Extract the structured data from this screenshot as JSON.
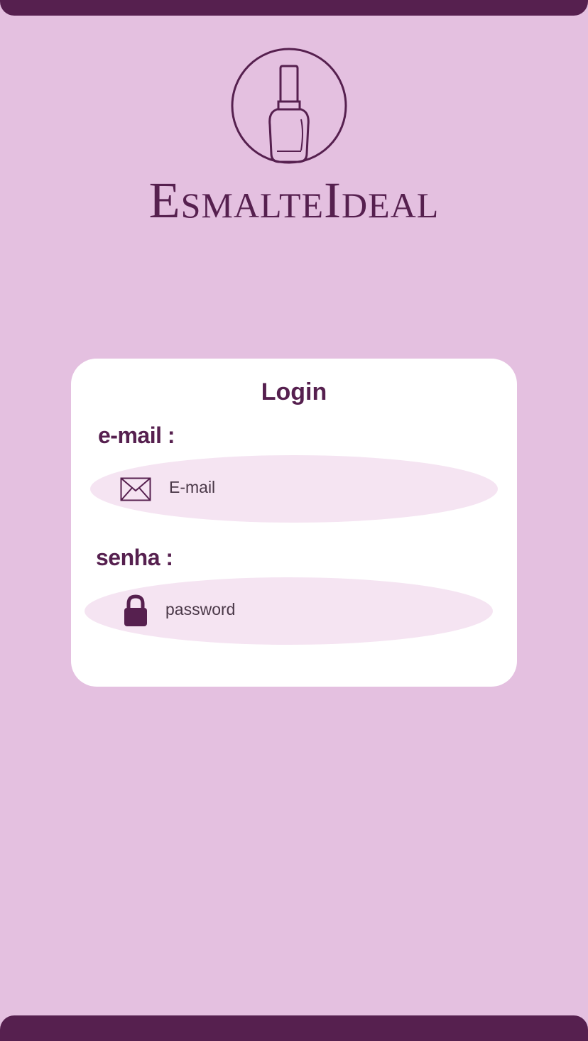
{
  "brand": {
    "name": "EsmalteIdeal"
  },
  "login": {
    "title": "Login",
    "email_label": "e-mail :",
    "email_placeholder": "E-mail",
    "password_label": "senha :",
    "password_placeholder": "password"
  },
  "icons": {
    "logo": "nail-polish-bottle-icon",
    "email": "envelope-icon",
    "password": "lock-icon"
  },
  "colors": {
    "background": "#e4c0e0",
    "brand": "#56204f",
    "card": "#ffffff",
    "field": "#f5e4f2"
  }
}
